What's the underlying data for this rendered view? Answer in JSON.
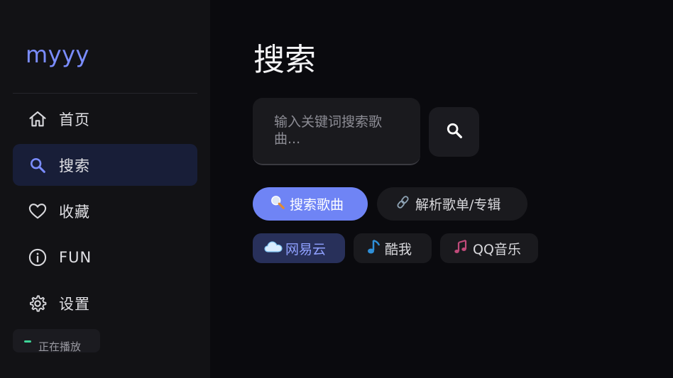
{
  "sidebar": {
    "brand": "myyy",
    "items": [
      {
        "label": "首页",
        "icon": "home-icon",
        "active": false
      },
      {
        "label": "搜索",
        "icon": "search-icon",
        "active": true
      },
      {
        "label": "收藏",
        "icon": "heart-icon",
        "active": false
      },
      {
        "label": "FUN",
        "icon": "info-icon",
        "active": false
      },
      {
        "label": "设置",
        "icon": "gear-icon",
        "active": false
      }
    ],
    "now_playing": {
      "status_text": "正在播放",
      "indicator_color": "#3ed598"
    }
  },
  "main": {
    "title": "搜索",
    "search": {
      "placeholder": "输入关键词搜索歌曲..."
    },
    "modes": [
      {
        "label": "搜索歌曲",
        "icon": "magnifier-emoji-icon",
        "active": true
      },
      {
        "label": "解析歌单/专辑",
        "icon": "link-emoji-icon",
        "active": false
      }
    ],
    "sources": [
      {
        "label": "网易云",
        "icon": "cloud-icon",
        "active": true
      },
      {
        "label": "酷我",
        "icon": "music-note-icon",
        "active": false
      },
      {
        "label": "QQ音乐",
        "icon": "music-notes-icon",
        "active": false
      }
    ]
  },
  "colors": {
    "accent": "#7b8dff",
    "accent_button": "#6f84f5",
    "sidebar_bg": "#121215",
    "main_bg": "#0a0a0e"
  }
}
